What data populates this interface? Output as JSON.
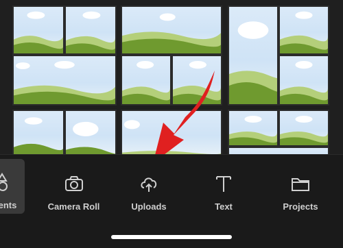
{
  "nav": {
    "items": [
      {
        "label": "ents",
        "icon": "elements-icon",
        "active": true
      },
      {
        "label": "Camera Roll",
        "icon": "camera-icon",
        "active": false
      },
      {
        "label": "Uploads",
        "icon": "cloud-upload-icon",
        "active": false
      },
      {
        "label": "Text",
        "icon": "text-icon",
        "active": false
      },
      {
        "label": "Projects",
        "icon": "folder-icon",
        "active": false
      }
    ]
  },
  "colors": {
    "background": "#1f1f1f",
    "navbar": "#1a1a1a",
    "sky": "#d6e8f7",
    "hill": "#6f9a2f",
    "arrow": "#e02020"
  }
}
